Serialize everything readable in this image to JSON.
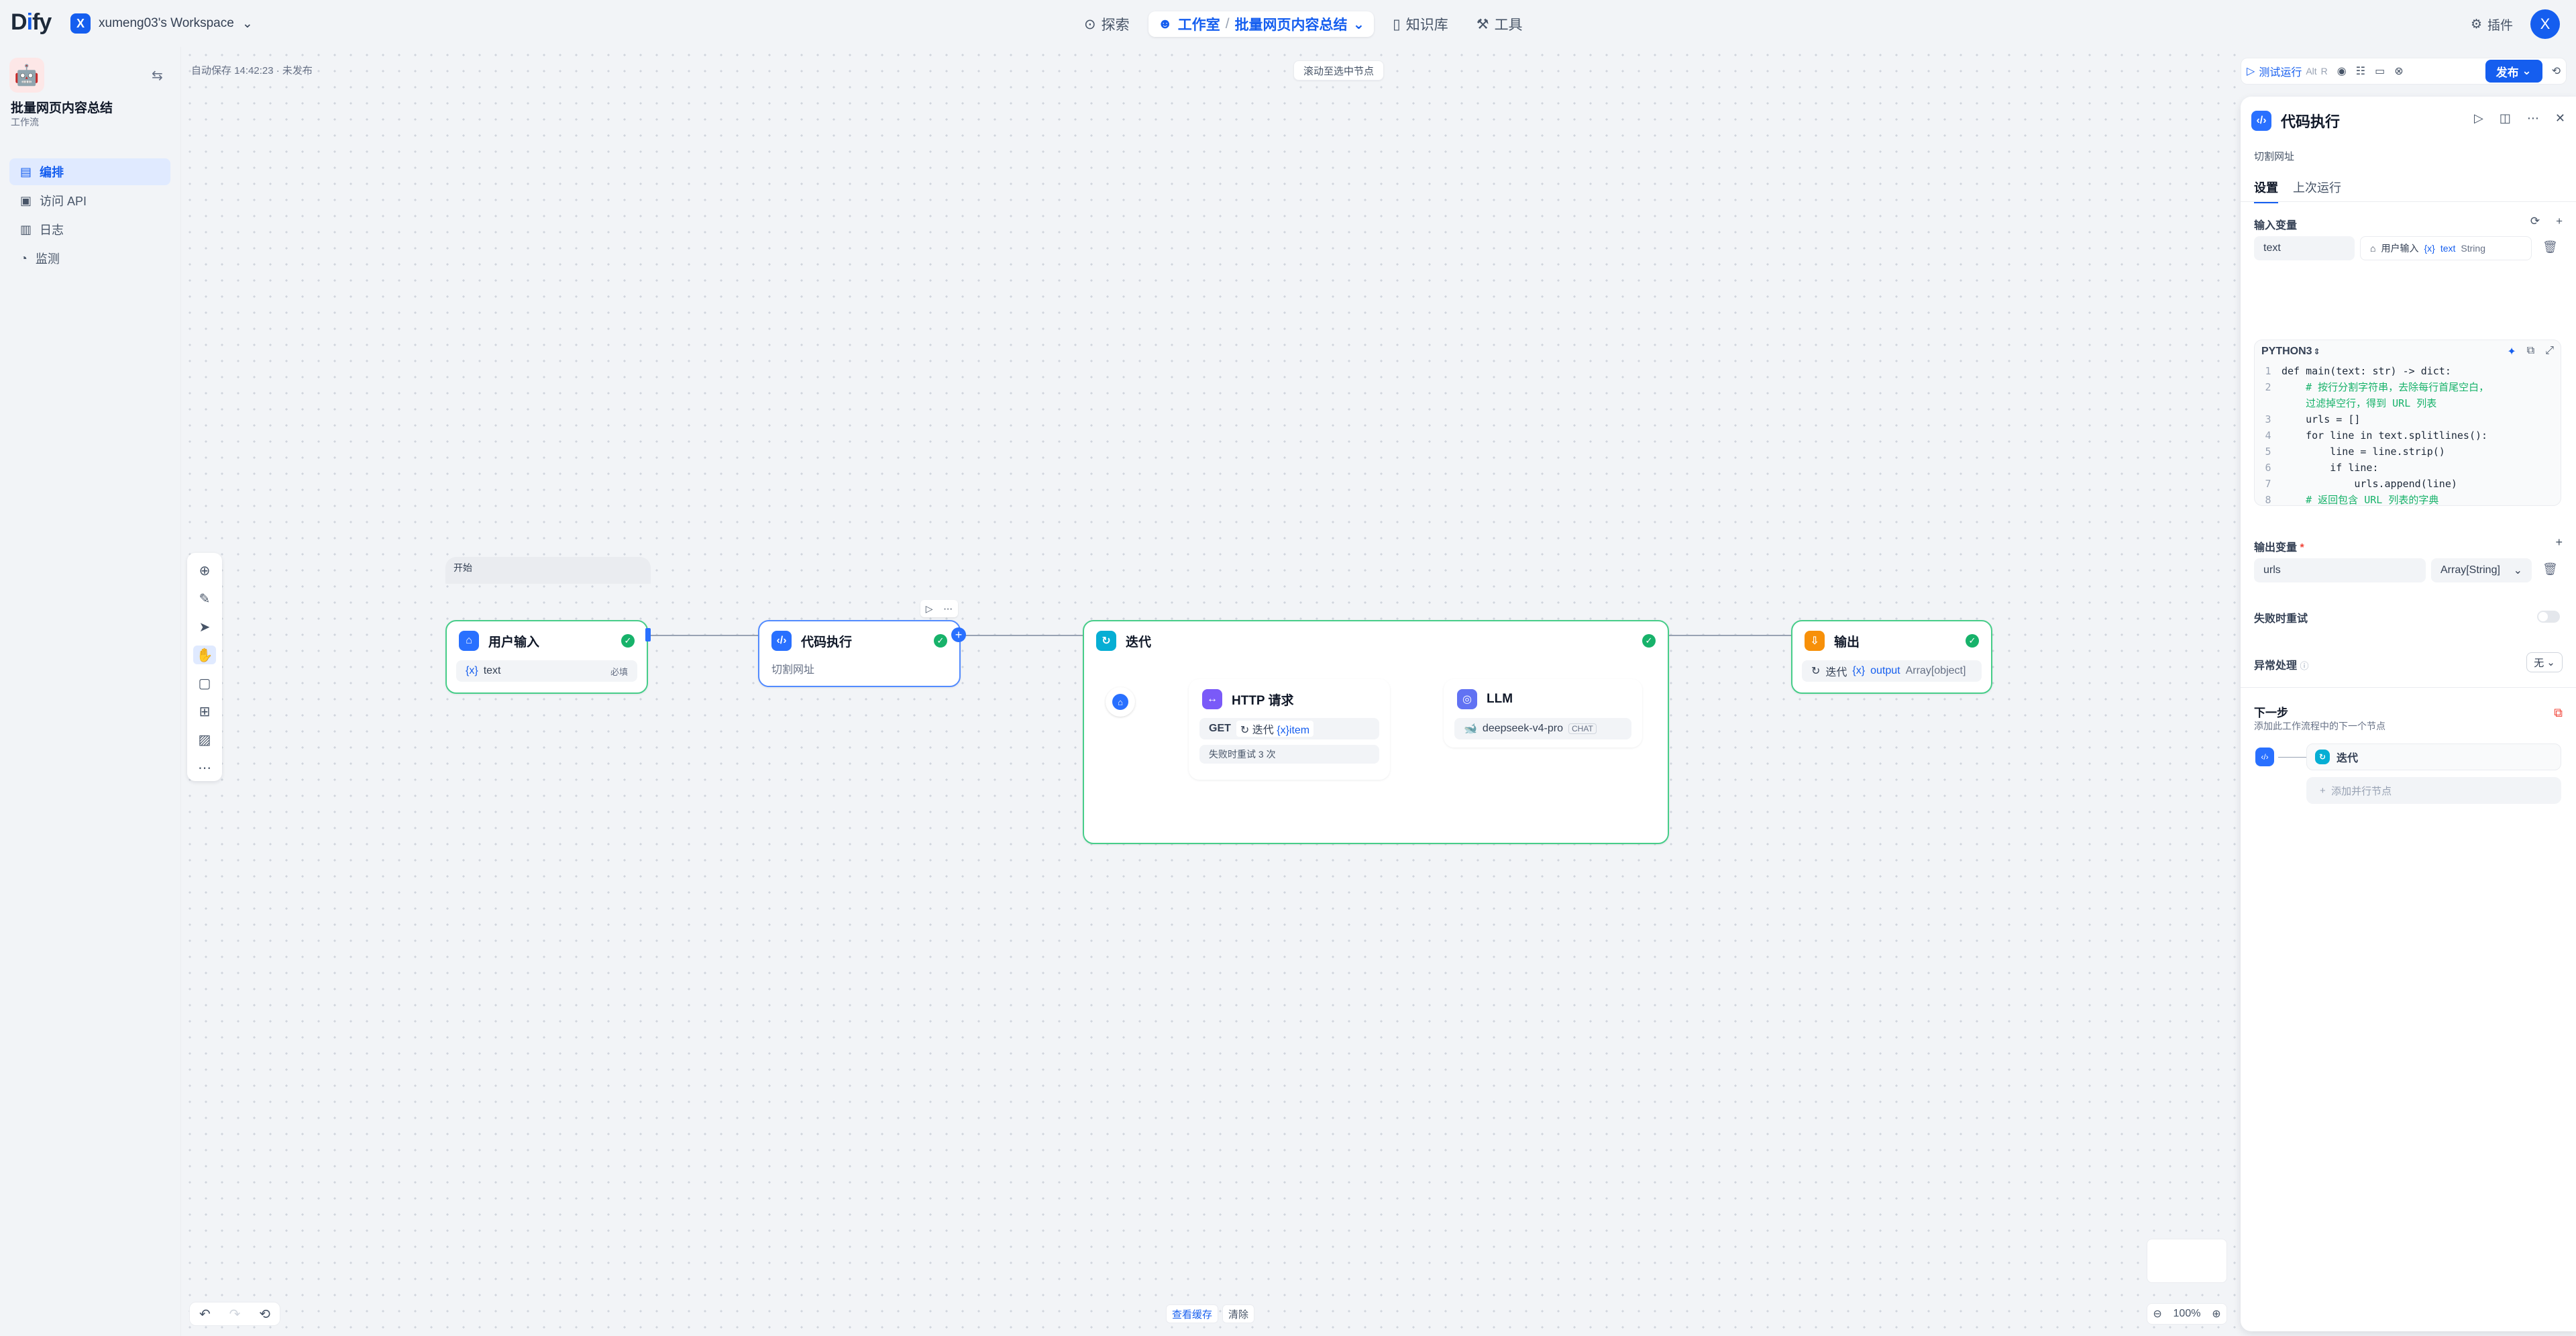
{
  "topbar": {
    "logo_pre": "D",
    "logo_i": "i",
    "logo_post": "fy",
    "workspace_badge": "X",
    "workspace_name": "xumeng03's Workspace",
    "nav": [
      {
        "label": "探索",
        "icon": "compass-icon"
      },
      {
        "label": "工作室",
        "icon": "robot-icon",
        "sub": "批量网页内容总结"
      },
      {
        "label": "知识库",
        "icon": "book-icon"
      },
      {
        "label": "工具",
        "icon": "wrench-icon"
      }
    ],
    "plugins_label": "插件",
    "avatar_letter": "X"
  },
  "sidebar": {
    "app_name": "批量网页内容总结",
    "app_type": "工作流",
    "items": [
      {
        "label": "编排",
        "icon": "layout-icon",
        "active": true
      },
      {
        "label": "访问 API",
        "icon": "terminal-icon"
      },
      {
        "label": "日志",
        "icon": "file-text-icon"
      },
      {
        "label": "监测",
        "icon": "activity-icon"
      }
    ]
  },
  "canvas": {
    "autosave": "自动保存 14:42:23 · 未发布",
    "scroll_hint": "滚动至选中节点",
    "start_tag": "开始",
    "nodes": {
      "user_input": {
        "title": "用户输入",
        "var": "text",
        "required": "必填"
      },
      "code": {
        "title": "代码执行",
        "desc": "切割网址"
      },
      "iteration": {
        "title": "迭代"
      },
      "http": {
        "title": "HTTP 请求",
        "method": "GET",
        "iter": "迭代",
        "var": "item",
        "retry": "失败时重试 3 次"
      },
      "llm": {
        "title": "LLM",
        "model": "deepseek-v4-pro",
        "mode": "CHAT"
      },
      "output": {
        "title": "输出",
        "iter": "迭代",
        "var": "output",
        "type": "Array[object]"
      }
    },
    "bottom": {
      "view_cache": "查看缓存",
      "clear": "清除",
      "zoom": "100%"
    }
  },
  "panel": {
    "toolbar": {
      "test_run": "测试运行",
      "shortcut_1": "Alt",
      "shortcut_2": "R",
      "publish": "发布"
    },
    "title": "代码执行",
    "desc": "切割网址",
    "tabs": [
      "设置",
      "上次运行"
    ],
    "input_label": "输入变量",
    "input_name": "text",
    "input_source": "用户输入",
    "input_var": "text",
    "input_type": "String",
    "lang": "PYTHON3",
    "code": [
      {
        "n": "1",
        "t": "def main(text: str) -> dict:",
        "k": "code"
      },
      {
        "n": "2",
        "t": "    # 按行分割字符串，去除每行首尾空白，",
        "k": "comment"
      },
      {
        "n": "",
        "t": "    过滤掉空行，得到 URL 列表",
        "k": "comment"
      },
      {
        "n": "3",
        "t": "    urls = []",
        "k": "code"
      },
      {
        "n": "4",
        "t": "    for line in text.splitlines():",
        "k": "code"
      },
      {
        "n": "5",
        "t": "        line = line.strip()",
        "k": "code"
      },
      {
        "n": "6",
        "t": "        if line:",
        "k": "code"
      },
      {
        "n": "7",
        "t": "            urls.append(line)",
        "k": "code"
      },
      {
        "n": "8",
        "t": "    # 返回包含 URL 列表的字典",
        "k": "comment"
      }
    ],
    "output_label": "输出变量",
    "output_required": "*",
    "output_name": "urls",
    "output_type": "Array[String]",
    "retry_label": "失败时重试",
    "error_label": "异常处理",
    "error_value": "无",
    "next_title": "下一步",
    "next_desc": "添加此工作流程中的下一个节点",
    "next_node": "迭代",
    "add_parallel": "添加并行节点"
  },
  "colors": {
    "accent": "#155eef",
    "success": "#17b26a",
    "border_green": "#47cd89"
  }
}
